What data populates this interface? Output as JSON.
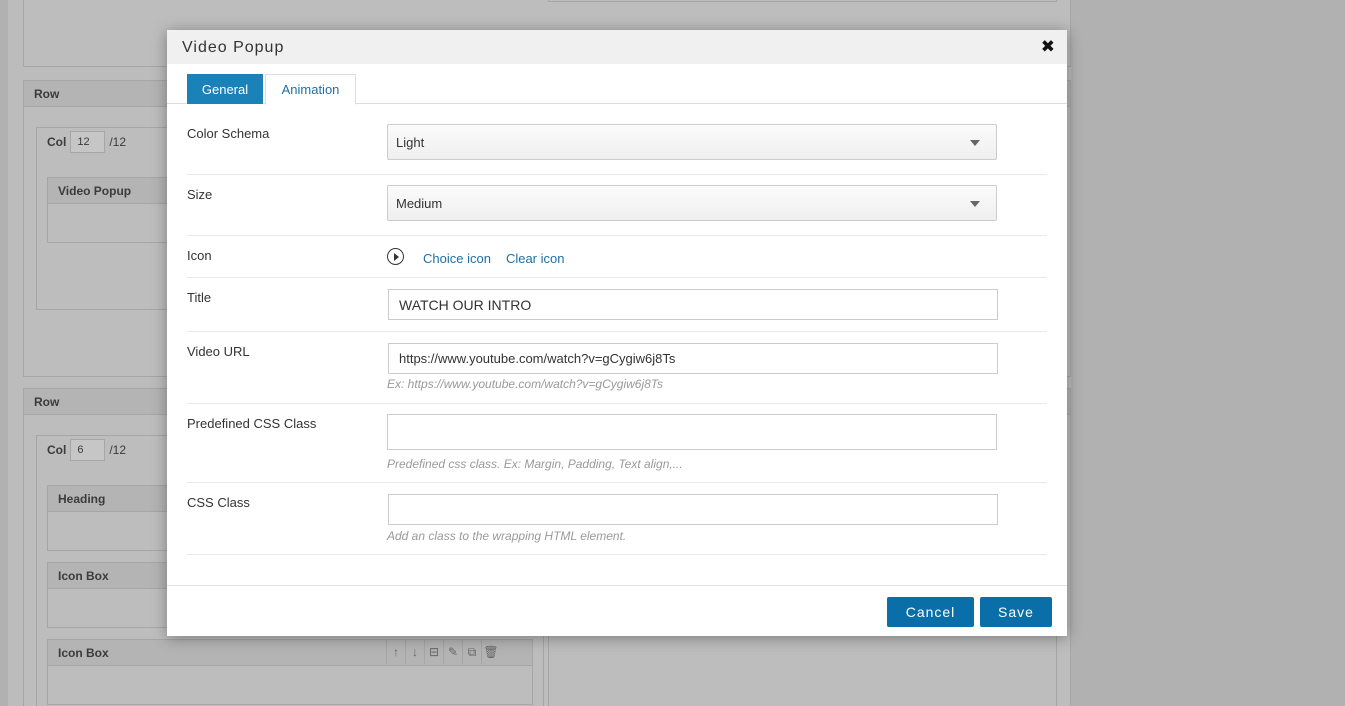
{
  "background": {
    "rows": [
      {
        "label": "Row"
      },
      {
        "label": "Row"
      }
    ],
    "cols": [
      {
        "label": "Col",
        "value": "12",
        "fraction": "/12"
      },
      {
        "label": "Col",
        "value": "6",
        "fraction": "/12"
      }
    ],
    "elements": {
      "video_popup": "Video Popup",
      "heading": "Heading",
      "icon_box_1": "Icon Box",
      "icon_box_2": "Icon Box"
    },
    "tool_icons": [
      "↑",
      "↓",
      "⊟",
      "✎",
      "⧉",
      "🗑"
    ]
  },
  "modal": {
    "title": "Video Popup",
    "close_glyph": "✖",
    "tabs": [
      {
        "label": "General",
        "active": true
      },
      {
        "label": "Animation",
        "active": false
      }
    ],
    "fields": {
      "color_schema": {
        "label": "Color Schema",
        "value": "Light"
      },
      "size": {
        "label": "Size",
        "value": "Medium"
      },
      "icon": {
        "label": "Icon",
        "icon_name": "play-circle-icon",
        "choice_label": "Choice icon",
        "clear_label": "Clear icon"
      },
      "title": {
        "label": "Title",
        "value": "WATCH OUR INTRO"
      },
      "video_url": {
        "label": "Video URL",
        "value": "https://www.youtube.com/watch?v=gCygiw6j8Ts",
        "hint": "Ex: https://www.youtube.com/watch?v=gCygiw6j8Ts"
      },
      "predefined_css": {
        "label": "Predefined CSS Class",
        "value": "",
        "hint": "Predefined css class. Ex: Margin, Padding, Text align,..."
      },
      "css_class": {
        "label": "CSS Class",
        "value": "",
        "hint": "Add an class to the wrapping HTML element."
      }
    },
    "footer": {
      "cancel_label": "Cancel",
      "save_label": "Save"
    }
  },
  "colors": {
    "primary": "#0a6fa8",
    "tab_active": "#1a82b8",
    "link": "#1f6fa3",
    "overlay": "#b1b1b1"
  }
}
